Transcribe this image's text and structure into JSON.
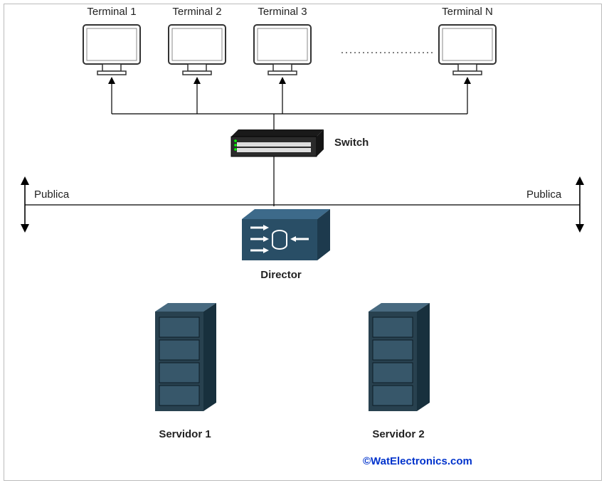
{
  "terminals": {
    "t1": "Terminal 1",
    "t2": "Terminal 2",
    "t3": "Terminal 3",
    "tN": "Terminal N"
  },
  "switch": {
    "label": "Switch"
  },
  "network": {
    "left": "Publica",
    "right": "Publica"
  },
  "director": {
    "label": "Director"
  },
  "servers": {
    "s1": "Servidor 1",
    "s2": "Servidor 2"
  },
  "credit": "©WatElectronics.com"
}
